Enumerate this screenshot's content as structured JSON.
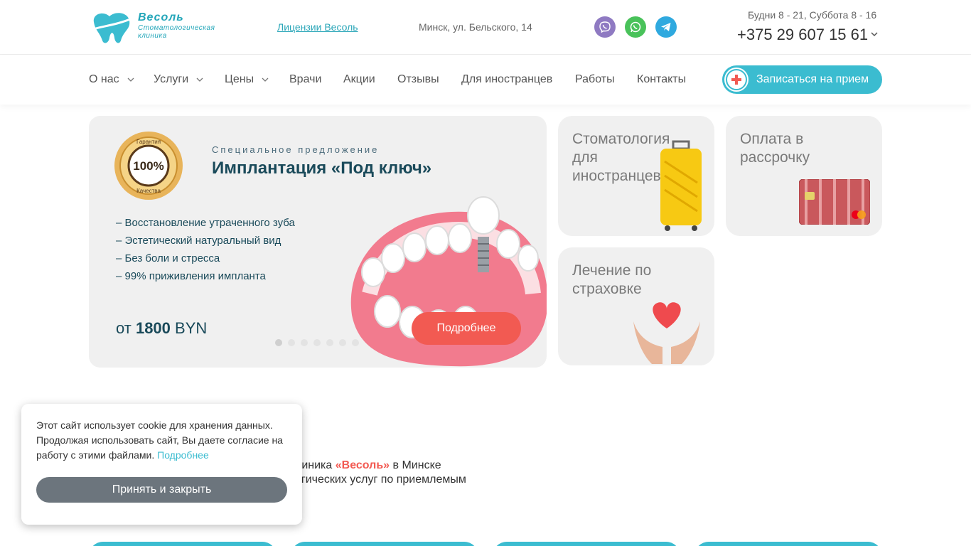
{
  "header": {
    "logo": {
      "name": "Весоль",
      "subtitle_line1": "Стоматологическая",
      "subtitle_line2": "клиника"
    },
    "license_link": "Лицензии Весоль",
    "address": "Минск, ул. Бельского, 14",
    "messengers": [
      "viber-icon",
      "whatsapp-icon",
      "telegram-icon"
    ],
    "hours": "Будни 8 - 21, Суббота 8 - 16",
    "phone": "+375 29 607 15 61"
  },
  "nav": {
    "items": [
      {
        "label": "О нас",
        "dropdown": true
      },
      {
        "label": "Услуги",
        "dropdown": true
      },
      {
        "label": "Цены",
        "dropdown": true
      },
      {
        "label": "Врачи",
        "dropdown": false
      },
      {
        "label": "Акции",
        "dropdown": false
      },
      {
        "label": "Отзывы",
        "dropdown": false
      },
      {
        "label": "Для иностранцев",
        "dropdown": false
      },
      {
        "label": "Работы",
        "dropdown": false
      },
      {
        "label": "Контакты",
        "dropdown": false
      }
    ],
    "book_button": "Записаться на прием"
  },
  "hero": {
    "seal_top": "Гарантия",
    "seal_value": "100%",
    "seal_bottom": "Качества",
    "kicker": "Специальное предложение",
    "title": "Имплантация «Под ключ»",
    "bullets": [
      "– Восстановление утраченного зуба",
      "– Эстетический натуральный вид",
      "– Без боли и стресса",
      "– 99% приживления импланта"
    ],
    "price_prefix": "от",
    "price_value": "1800",
    "price_currency": "BYN",
    "button": "Подробнее",
    "slide_count": 7,
    "active_slide": 1
  },
  "cards": [
    {
      "title": "Стоматология для иностранцев",
      "icon": "suitcase-icon"
    },
    {
      "title": "Оплата в рассрочку",
      "icon": "bank-card-icon"
    },
    {
      "title": "Лечение по страховке",
      "icon": "heart-hands-icon"
    }
  ],
  "intro": {
    "line1_visible_start": "линика",
    "brand": "«Весоль»",
    "line1_end": "в Минске",
    "line2_visible": "огических услуг по приемлемым"
  },
  "cookie": {
    "text": "Этот сайт использует cookie для хранения данных. Продолжая использовать сайт, Вы даете согласие на работу с этими файлами.",
    "link": "Подробнее",
    "button": "Принять и закрыть"
  },
  "colors": {
    "accent": "#3bbcd0",
    "brand_red": "#f25a52",
    "cookie_button": "#6c757d",
    "card_bg": "#f0f0f0"
  }
}
